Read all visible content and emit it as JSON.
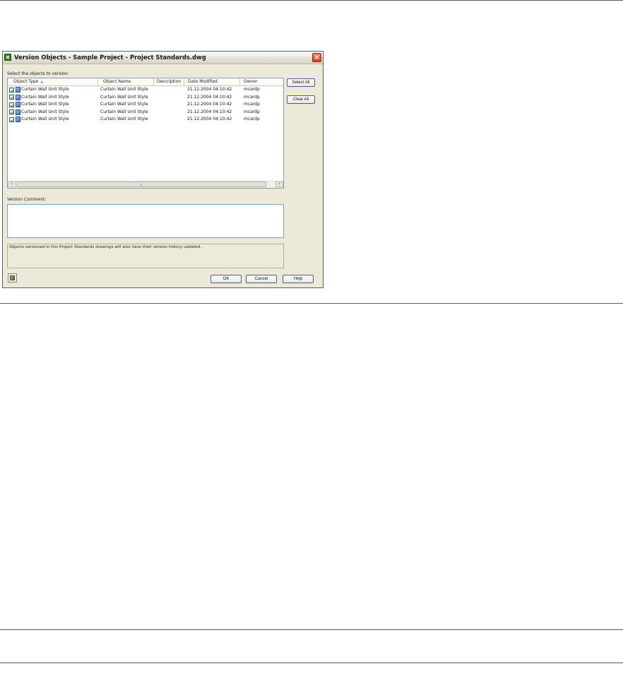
{
  "dialog": {
    "title": "Version Objects - Sample Project - Project Standards.dwg",
    "select_prompt": "Select the objects to version:",
    "columns": [
      "Object Type",
      "Object Name",
      "Description",
      "Date Modified",
      "Owner"
    ],
    "rows": [
      {
        "checked": true,
        "object_type": "Curtain Wall Unit Style",
        "object_name": "Curtain Wall Unit Style",
        "description": "",
        "date_modified": "21.12.2004 04:10:42",
        "owner": "mcardp"
      },
      {
        "checked": true,
        "object_type": "Curtain Wall Unit Style",
        "object_name": "Curtain Wall Unit Style",
        "description": "",
        "date_modified": "21.12.2004 04:10:42",
        "owner": "mcardp"
      },
      {
        "checked": true,
        "object_type": "Curtain Wall Unit Style",
        "object_name": "Curtain Wall Unit Style",
        "description": "",
        "date_modified": "21.12.2004 04:10:42",
        "owner": "mcardp"
      },
      {
        "checked": true,
        "object_type": "Curtain Wall Unit Style",
        "object_name": "Curtain Wall Unit Style",
        "description": "",
        "date_modified": "21.12.2004 04:10:42",
        "owner": "mcardp"
      },
      {
        "checked": true,
        "object_type": "Curtain Wall Unit Style",
        "object_name": "Curtain Wall Unit Style",
        "description": "",
        "date_modified": "21.12.2004 04:10:42",
        "owner": "mcardp"
      }
    ],
    "select_all_label": "Select All",
    "clear_all_label": "Clear All",
    "version_comment_label": "Version Comment:",
    "version_comment_value": "",
    "info_text": "Objects versioned in this Project Standards drawings will also have their version history updated.",
    "ok_label": "OK",
    "cancel_label": "Cancel",
    "help_label": "Help"
  },
  "icons": {
    "title": "app-icon",
    "close": "close-icon",
    "row": "object-style-icon",
    "tool": "project-tool-icon"
  }
}
